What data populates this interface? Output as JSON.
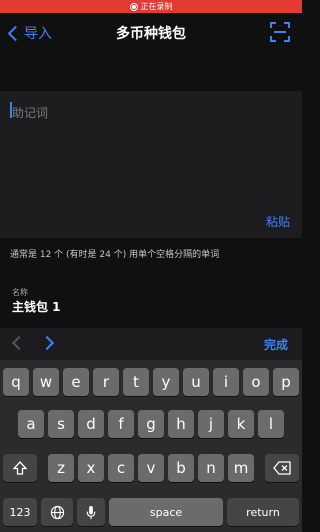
{
  "status_bar": {
    "recording_text": "正在录制"
  },
  "nav": {
    "back_label": "导入",
    "title": "多币种钱包"
  },
  "mnemonic": {
    "placeholder": "助记词",
    "paste_label": "粘贴"
  },
  "hint": "通常是 12 个 (有时是 24 个) 用单个空格分隔的单词",
  "name_field": {
    "label": "名称",
    "value": "主钱包 1"
  },
  "accessory": {
    "done_label": "完成"
  },
  "keyboard": {
    "row1": [
      "q",
      "w",
      "e",
      "r",
      "t",
      "y",
      "u",
      "i",
      "o",
      "p"
    ],
    "row2": [
      "a",
      "s",
      "d",
      "f",
      "g",
      "h",
      "j",
      "k",
      "l"
    ],
    "row3": [
      "z",
      "x",
      "c",
      "v",
      "b",
      "n",
      "m"
    ],
    "numbers_label": "123",
    "space_label": "space",
    "return_label": "return"
  }
}
